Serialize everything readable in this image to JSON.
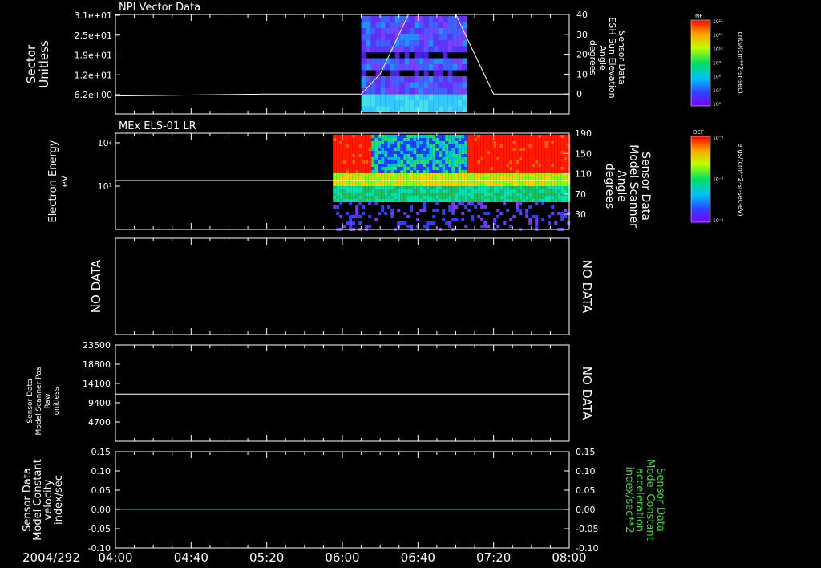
{
  "colors": {
    "background": "#000000",
    "foreground": "#ffffff",
    "green_series": "#33dd33"
  },
  "chart_data": [
    {
      "id": "panel1",
      "type": "heatmap",
      "title": "NPI Vector Data",
      "ylabel": [
        "Sector",
        "Unitless"
      ],
      "yticks_left": [
        "3.1e+01",
        "2.5e+01",
        "1.9e+01",
        "1.2e+01",
        "6.2e+00"
      ],
      "right_label": [
        "Sensor Data",
        "ESH Sun Elevation",
        "Angle",
        "degrees"
      ],
      "yticks_right": [
        "40",
        "30",
        "20",
        "10",
        "0"
      ],
      "yrange_right": [
        -10,
        40
      ],
      "line_series": {
        "name": "ESH Sun Elevation Angle",
        "x": [
          "04:00",
          "05:20",
          "06:10",
          "06:20",
          "06:30",
          "06:35",
          "07:00",
          "07:05",
          "07:15",
          "07:20",
          "08:00"
        ],
        "y": [
          -1,
          0,
          0,
          10,
          30,
          40,
          40,
          30,
          10,
          0,
          0
        ]
      },
      "colorbar": {
        "label": "NF",
        "units": "cnts/(cm**2-sr-sec)",
        "ticks": [
          "10¹²",
          "10¹¹",
          "10¹⁰",
          "10⁹",
          "10⁸",
          "10⁷",
          "10⁶"
        ]
      }
    },
    {
      "id": "panel2",
      "type": "heatmap",
      "title": "MEx ELS-01 LR",
      "ylabel": [
        "Electron Energy",
        "eV"
      ],
      "yticks_left": [
        "10²",
        "10¹"
      ],
      "right_label": [
        "Sensor Data",
        "Model Scanner",
        "Angle",
        "degrees"
      ],
      "yticks_right": [
        "190",
        "150",
        "110",
        "70",
        "30"
      ],
      "yrange_right": [
        0,
        190
      ],
      "line_series": {
        "name": "Model Scanner Angle",
        "x": [
          "04:00",
          "08:00"
        ],
        "y": [
          95,
          95
        ]
      },
      "colorbar": {
        "label": "DEF",
        "units": "ergs/(cm**2-sr-sec-eV)",
        "ticks": [
          "10⁻⁴",
          "10⁻⁵",
          "10⁻⁶"
        ]
      }
    },
    {
      "id": "panel3",
      "type": "line",
      "left_label": "NO DATA",
      "right_label": "NO DATA"
    },
    {
      "id": "panel4",
      "type": "line",
      "ylabel": [
        "Sensor Data",
        "Model Scanner Pos",
        "Raw",
        "unitless"
      ],
      "yticks_left": [
        "23500",
        "18800",
        "14100",
        "9400",
        "4700"
      ],
      "yrange": [
        0,
        23500
      ],
      "series": [
        {
          "x": [
            "04:00",
            "08:00"
          ],
          "y": [
            11500,
            11500
          ]
        }
      ],
      "right_label": "NO DATA"
    },
    {
      "id": "panel5",
      "type": "line",
      "ylabel": [
        "Sensor Data",
        "Model Constant",
        "velocity",
        "index/sec"
      ],
      "yticks_left": [
        "0.15",
        "0.10",
        "0.05",
        "0.00",
        "-0.05",
        "-0.10"
      ],
      "yticks_right": [
        "0.15",
        "0.10",
        "0.05",
        "0.00",
        "-0.05",
        "-0.10"
      ],
      "yrange": [
        -0.1,
        0.15
      ],
      "right_label": [
        "Sensor Data",
        "Model Constant",
        "acceleration",
        "index/sec**2"
      ],
      "series": [
        {
          "x": [
            "04:00",
            "08:00"
          ],
          "y": [
            0,
            0
          ],
          "color": "#ffffff"
        },
        {
          "x": [
            "04:00",
            "08:00"
          ],
          "y": [
            0,
            0
          ],
          "color": "#33dd33"
        }
      ]
    }
  ],
  "time_axis": {
    "date_label": "2004/292",
    "tick_labels": [
      "04:00",
      "04:40",
      "05:20",
      "06:00",
      "06:40",
      "07:20",
      "08:00"
    ],
    "range": [
      "04:00",
      "08:00"
    ]
  }
}
